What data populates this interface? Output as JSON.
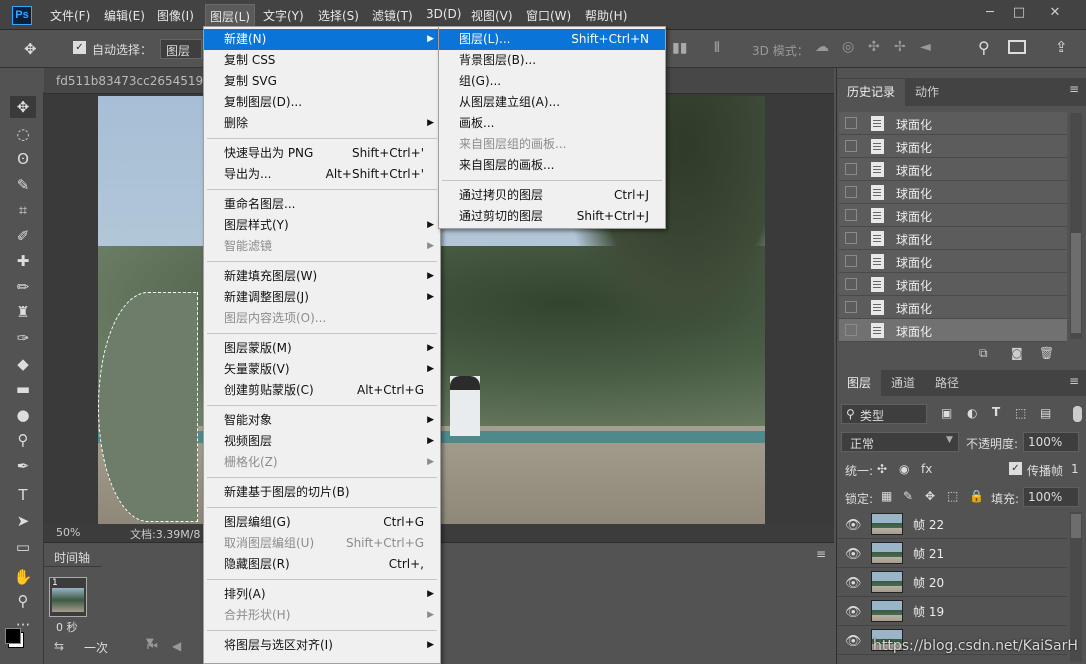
{
  "app": {
    "logo": "Ps"
  },
  "menubar": [
    "文件(F)",
    "编辑(E)",
    "图像(I)",
    "图层(L)",
    "文字(Y)",
    "选择(S)",
    "滤镜(T)",
    "3D(D)",
    "视图(V)",
    "窗口(W)",
    "帮助(H)"
  ],
  "window_buttons": [
    "─",
    "□",
    "✕"
  ],
  "options": {
    "auto_select_label": "自动选择：",
    "auto_select_value": "图层",
    "mode_3d": "3D 模式："
  },
  "document": {
    "tab_title": "fd511b83473cc2654519e8",
    "zoom": "50%",
    "doc_info": "文档:3.39M/8"
  },
  "timeline": {
    "title": "时间轴",
    "frame_number": "1",
    "frame_time": "0 秒",
    "loop": "一次"
  },
  "history": {
    "tabs": [
      "历史记录",
      "动作"
    ],
    "items": [
      "球面化",
      "球面化",
      "球面化",
      "球面化",
      "球面化",
      "球面化",
      "球面化",
      "球面化",
      "球面化",
      "球面化"
    ]
  },
  "layers": {
    "tabs": [
      "图层",
      "通道",
      "路径"
    ],
    "filter": "类型",
    "blend_mode": "正常",
    "opacity_label": "不透明度:",
    "opacity": "100%",
    "unify_label": "统一:",
    "propagate_label": "传播帧",
    "propagate_value": "1",
    "lock_label": "锁定:",
    "fill_label": "填充:",
    "fill": "100%",
    "rows": [
      "帧 22",
      "帧 21",
      "帧 20",
      "帧 19"
    ]
  },
  "menu_layer": {
    "items": [
      {
        "label": "新建(N)",
        "shortcut": "",
        "submenu": true,
        "disabled": false,
        "highlight": true
      },
      {
        "label": "复制 CSS",
        "shortcut": "",
        "submenu": false,
        "disabled": false
      },
      {
        "label": "复制 SVG",
        "shortcut": "",
        "submenu": false,
        "disabled": false
      },
      {
        "label": "复制图层(D)...",
        "shortcut": "",
        "submenu": false,
        "disabled": false
      },
      {
        "label": "删除",
        "shortcut": "",
        "submenu": true,
        "disabled": false
      },
      {
        "label": "快速导出为 PNG",
        "shortcut": "Shift+Ctrl+'",
        "submenu": false,
        "disabled": false
      },
      {
        "label": "导出为...",
        "shortcut": "Alt+Shift+Ctrl+'",
        "submenu": false,
        "disabled": false
      },
      {
        "label": "重命名图层...",
        "shortcut": "",
        "submenu": false,
        "disabled": false
      },
      {
        "label": "图层样式(Y)",
        "shortcut": "",
        "submenu": true,
        "disabled": false
      },
      {
        "label": "智能滤镜",
        "shortcut": "",
        "submenu": true,
        "disabled": true
      },
      {
        "label": "新建填充图层(W)",
        "shortcut": "",
        "submenu": true,
        "disabled": false
      },
      {
        "label": "新建调整图层(J)",
        "shortcut": "",
        "submenu": true,
        "disabled": false
      },
      {
        "label": "图层内容选项(O)...",
        "shortcut": "",
        "submenu": false,
        "disabled": true
      },
      {
        "label": "图层蒙版(M)",
        "shortcut": "",
        "submenu": true,
        "disabled": false
      },
      {
        "label": "矢量蒙版(V)",
        "shortcut": "",
        "submenu": true,
        "disabled": false
      },
      {
        "label": "创建剪贴蒙版(C)",
        "shortcut": "Alt+Ctrl+G",
        "submenu": false,
        "disabled": false
      },
      {
        "label": "智能对象",
        "shortcut": "",
        "submenu": true,
        "disabled": false
      },
      {
        "label": "视频图层",
        "shortcut": "",
        "submenu": true,
        "disabled": false
      },
      {
        "label": "栅格化(Z)",
        "shortcut": "",
        "submenu": true,
        "disabled": true
      },
      {
        "label": "新建基于图层的切片(B)",
        "shortcut": "",
        "submenu": false,
        "disabled": false
      },
      {
        "label": "图层编组(G)",
        "shortcut": "Ctrl+G",
        "submenu": false,
        "disabled": false
      },
      {
        "label": "取消图层编组(U)",
        "shortcut": "Shift+Ctrl+G",
        "submenu": false,
        "disabled": true
      },
      {
        "label": "隐藏图层(R)",
        "shortcut": "Ctrl+,",
        "submenu": false,
        "disabled": false
      },
      {
        "label": "排列(A)",
        "shortcut": "",
        "submenu": true,
        "disabled": false
      },
      {
        "label": "合并形状(H)",
        "shortcut": "",
        "submenu": true,
        "disabled": true
      },
      {
        "label": "将图层与选区对齐(I)",
        "shortcut": "",
        "submenu": true,
        "disabled": false
      }
    ]
  },
  "menu_new": {
    "items": [
      {
        "label": "图层(L)...",
        "shortcut": "Shift+Ctrl+N",
        "disabled": false,
        "highlight": true
      },
      {
        "label": "背景图层(B)...",
        "shortcut": "",
        "disabled": false
      },
      {
        "label": "组(G)...",
        "shortcut": "",
        "disabled": false
      },
      {
        "label": "从图层建立组(A)...",
        "shortcut": "",
        "disabled": false
      },
      {
        "label": "画板...",
        "shortcut": "",
        "disabled": false
      },
      {
        "label": "来自图层组的画板...",
        "shortcut": "",
        "disabled": true
      },
      {
        "label": "来自图层的画板...",
        "shortcut": "",
        "disabled": false
      },
      {
        "label": "通过拷贝的图层",
        "shortcut": "Ctrl+J",
        "disabled": false
      },
      {
        "label": "通过剪切的图层",
        "shortcut": "Shift+Ctrl+J",
        "disabled": false
      }
    ]
  },
  "watermark": "https://blog.csdn.net/KaiSarH"
}
